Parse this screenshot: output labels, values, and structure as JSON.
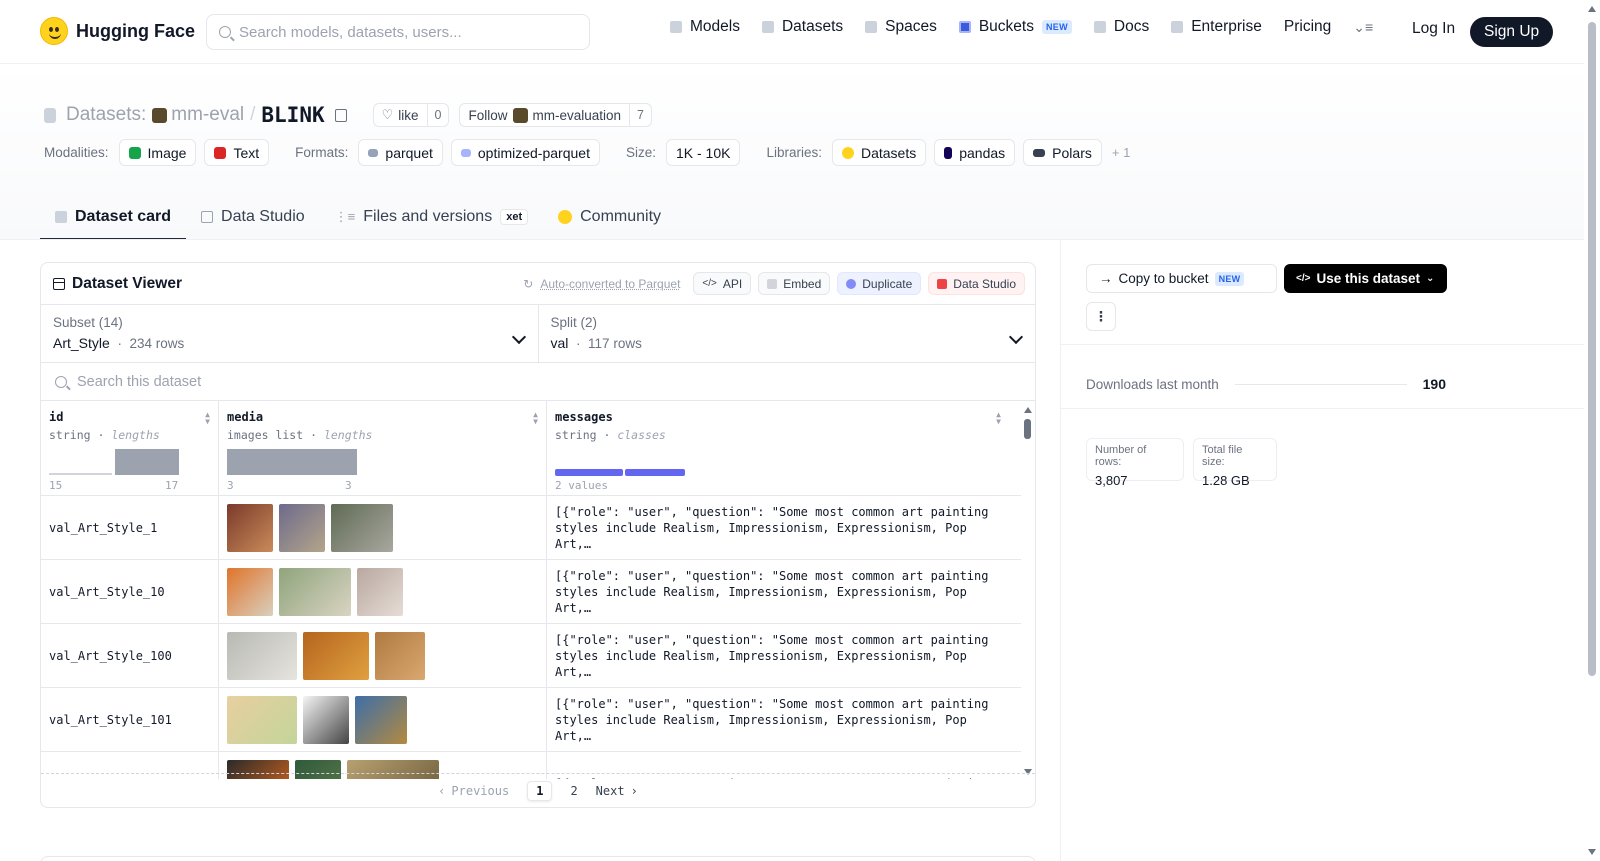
{
  "nav": {
    "brand": "Hugging Face",
    "search_placeholder": "Search models, datasets, users...",
    "links": [
      {
        "label": "Models"
      },
      {
        "label": "Datasets"
      },
      {
        "label": "Spaces"
      },
      {
        "label": "Buckets",
        "badge": "NEW"
      },
      {
        "label": "Docs"
      },
      {
        "label": "Enterprise"
      },
      {
        "label": "Pricing"
      }
    ],
    "login": "Log In",
    "signup": "Sign Up"
  },
  "header": {
    "prefix": "Datasets:",
    "org": "mm-eval",
    "separator": "/",
    "name": "BLINK",
    "like_label": "like",
    "like_count": "0",
    "follow_label": "Follow",
    "follow_org": "mm-evaluation",
    "follow_count": "7",
    "modalities_label": "Modalities:",
    "modalities": [
      "Image",
      "Text"
    ],
    "formats_label": "Formats:",
    "formats": [
      "parquet",
      "optimized-parquet"
    ],
    "size_label": "Size:",
    "size": "1K - 10K",
    "libraries_label": "Libraries:",
    "libraries": [
      "Datasets",
      "pandas",
      "Polars"
    ],
    "libraries_more": "+ 1"
  },
  "tabs": [
    {
      "label": "Dataset card",
      "active": true
    },
    {
      "label": "Data Studio"
    },
    {
      "label": "Files and versions",
      "badge": "xet"
    },
    {
      "label": "Community"
    }
  ],
  "viewer": {
    "title": "Dataset Viewer",
    "auto_converted": "Auto-converted to Parquet",
    "actions": [
      "API",
      "Embed",
      "Duplicate",
      "Data Studio"
    ],
    "subset_label": "Subset (14)",
    "subset_value": "Art_Style",
    "subset_rows": "234 rows",
    "split_label": "Split (2)",
    "split_value": "val",
    "split_rows": "117 rows",
    "search_placeholder": "Search this dataset",
    "columns": [
      {
        "name": "id",
        "type": "string",
        "stat": "lengths",
        "min": "15",
        "max": "17"
      },
      {
        "name": "media",
        "type": "images list",
        "stat": "lengths",
        "min": "3",
        "max": "3"
      },
      {
        "name": "messages",
        "type": "string",
        "stat": "classes",
        "summary": "2 values"
      }
    ],
    "rows": [
      {
        "id": "val_Art_Style_1",
        "message": "[{\"role\": \"user\", \"question\": \"Some most common art painting\nstyles include Realism, Impressionism, Expressionism, Pop Art,…",
        "thumbs": [
          [
            "#7b3a2a",
            "#c98b5a",
            46
          ],
          [
            "#6e6a8c",
            "#b3a58a",
            46
          ],
          [
            "#5f6b54",
            "#a9a7a0",
            62
          ]
        ]
      },
      {
        "id": "val_Art_Style_10",
        "message": "[{\"role\": \"user\", \"question\": \"Some most common art painting\nstyles include Realism, Impressionism, Expressionism, Pop Art,…",
        "thumbs": [
          [
            "#e0742a",
            "#d8d0c0",
            46
          ],
          [
            "#8fa47c",
            "#d9d4c2",
            72
          ],
          [
            "#b8a8a0",
            "#e6dcd6",
            46
          ]
        ]
      },
      {
        "id": "val_Art_Style_100",
        "message": "[{\"role\": \"user\", \"question\": \"Some most common art painting\nstyles include Realism, Impressionism, Expressionism, Pop Art,…",
        "thumbs": [
          [
            "#b9b9b4",
            "#e5e4de",
            70
          ],
          [
            "#b5651d",
            "#e0a040",
            66
          ],
          [
            "#b07a40",
            "#d9a870",
            50
          ]
        ]
      },
      {
        "id": "val_Art_Style_101",
        "message": "[{\"role\": \"user\", \"question\": \"Some most common art painting\nstyles include Realism, Impressionism, Expressionism, Pop Art,…",
        "thumbs": [
          [
            "#e8cfa0",
            "#c3d59a",
            70
          ],
          [
            "#f5f5f5",
            "#444444",
            46
          ],
          [
            "#3d6ea8",
            "#b38a40",
            52
          ]
        ]
      },
      {
        "id": "",
        "message": "[{\"role\": \"user\", \"question\": \"Some most common art painting",
        "thumbs": [
          [
            "#2a2a2a",
            "#e06a1c",
            62
          ],
          [
            "#2f5a3a",
            "#5d7a4d",
            46
          ],
          [
            "#b8a070",
            "#6a5a3a",
            92
          ]
        ]
      }
    ],
    "pager": {
      "prev": "Previous",
      "pages": [
        "1",
        "2"
      ],
      "next": "Next"
    }
  },
  "sidebar": {
    "copy_bucket": "Copy to bucket",
    "copy_badge": "NEW",
    "use_dataset": "Use this dataset",
    "downloads_label": "Downloads last month",
    "downloads_value": "190",
    "rows_label": "Number of rows:",
    "rows_value": "3,807",
    "size_label": "Total file size:",
    "size_value": "1.28 GB"
  }
}
